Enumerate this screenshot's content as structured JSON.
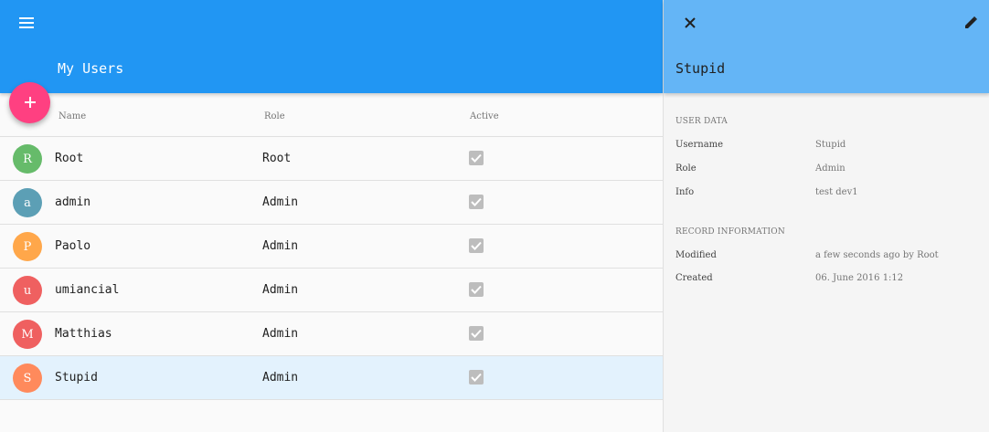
{
  "app": {
    "title": "My Users",
    "menu_icon": "menu-icon",
    "add_icon": "plus-icon",
    "primary_color": "#2196f3",
    "accent_color": "#ff4081"
  },
  "table": {
    "headers": {
      "name": "Name",
      "role": "Role",
      "active": "Active"
    },
    "rows": [
      {
        "initial": "R",
        "name": "Root",
        "role": "Root",
        "active": true,
        "avatar_color": "#66bb6a"
      },
      {
        "initial": "a",
        "name": "admin",
        "role": "Admin",
        "active": true,
        "avatar_color": "#5c9fb5"
      },
      {
        "initial": "P",
        "name": "Paolo",
        "role": "Admin",
        "active": true,
        "avatar_color": "#ffa74a"
      },
      {
        "initial": "u",
        "name": "umiancial",
        "role": "Admin",
        "active": true,
        "avatar_color": "#ef6060"
      },
      {
        "initial": "M",
        "name": "Matthias",
        "role": "Admin",
        "active": true,
        "avatar_color": "#ef6060"
      },
      {
        "initial": "S",
        "name": "Stupid",
        "role": "Admin",
        "active": true,
        "avatar_color": "#ff8a5c",
        "selected": true
      }
    ]
  },
  "detail": {
    "title": "Stupid",
    "close_icon": "close-icon",
    "edit_icon": "pencil-icon",
    "user_data_label": "USER DATA",
    "user_data": [
      {
        "key": "Username",
        "value": "Stupid"
      },
      {
        "key": "Role",
        "value": "Admin"
      },
      {
        "key": "Info",
        "value": "test dev1"
      }
    ],
    "record_label": "RECORD INFORMATION",
    "record": [
      {
        "key": "Modified",
        "value": "a few seconds ago by Root"
      },
      {
        "key": "Created",
        "value": "06. June 2016 1:12"
      }
    ]
  }
}
